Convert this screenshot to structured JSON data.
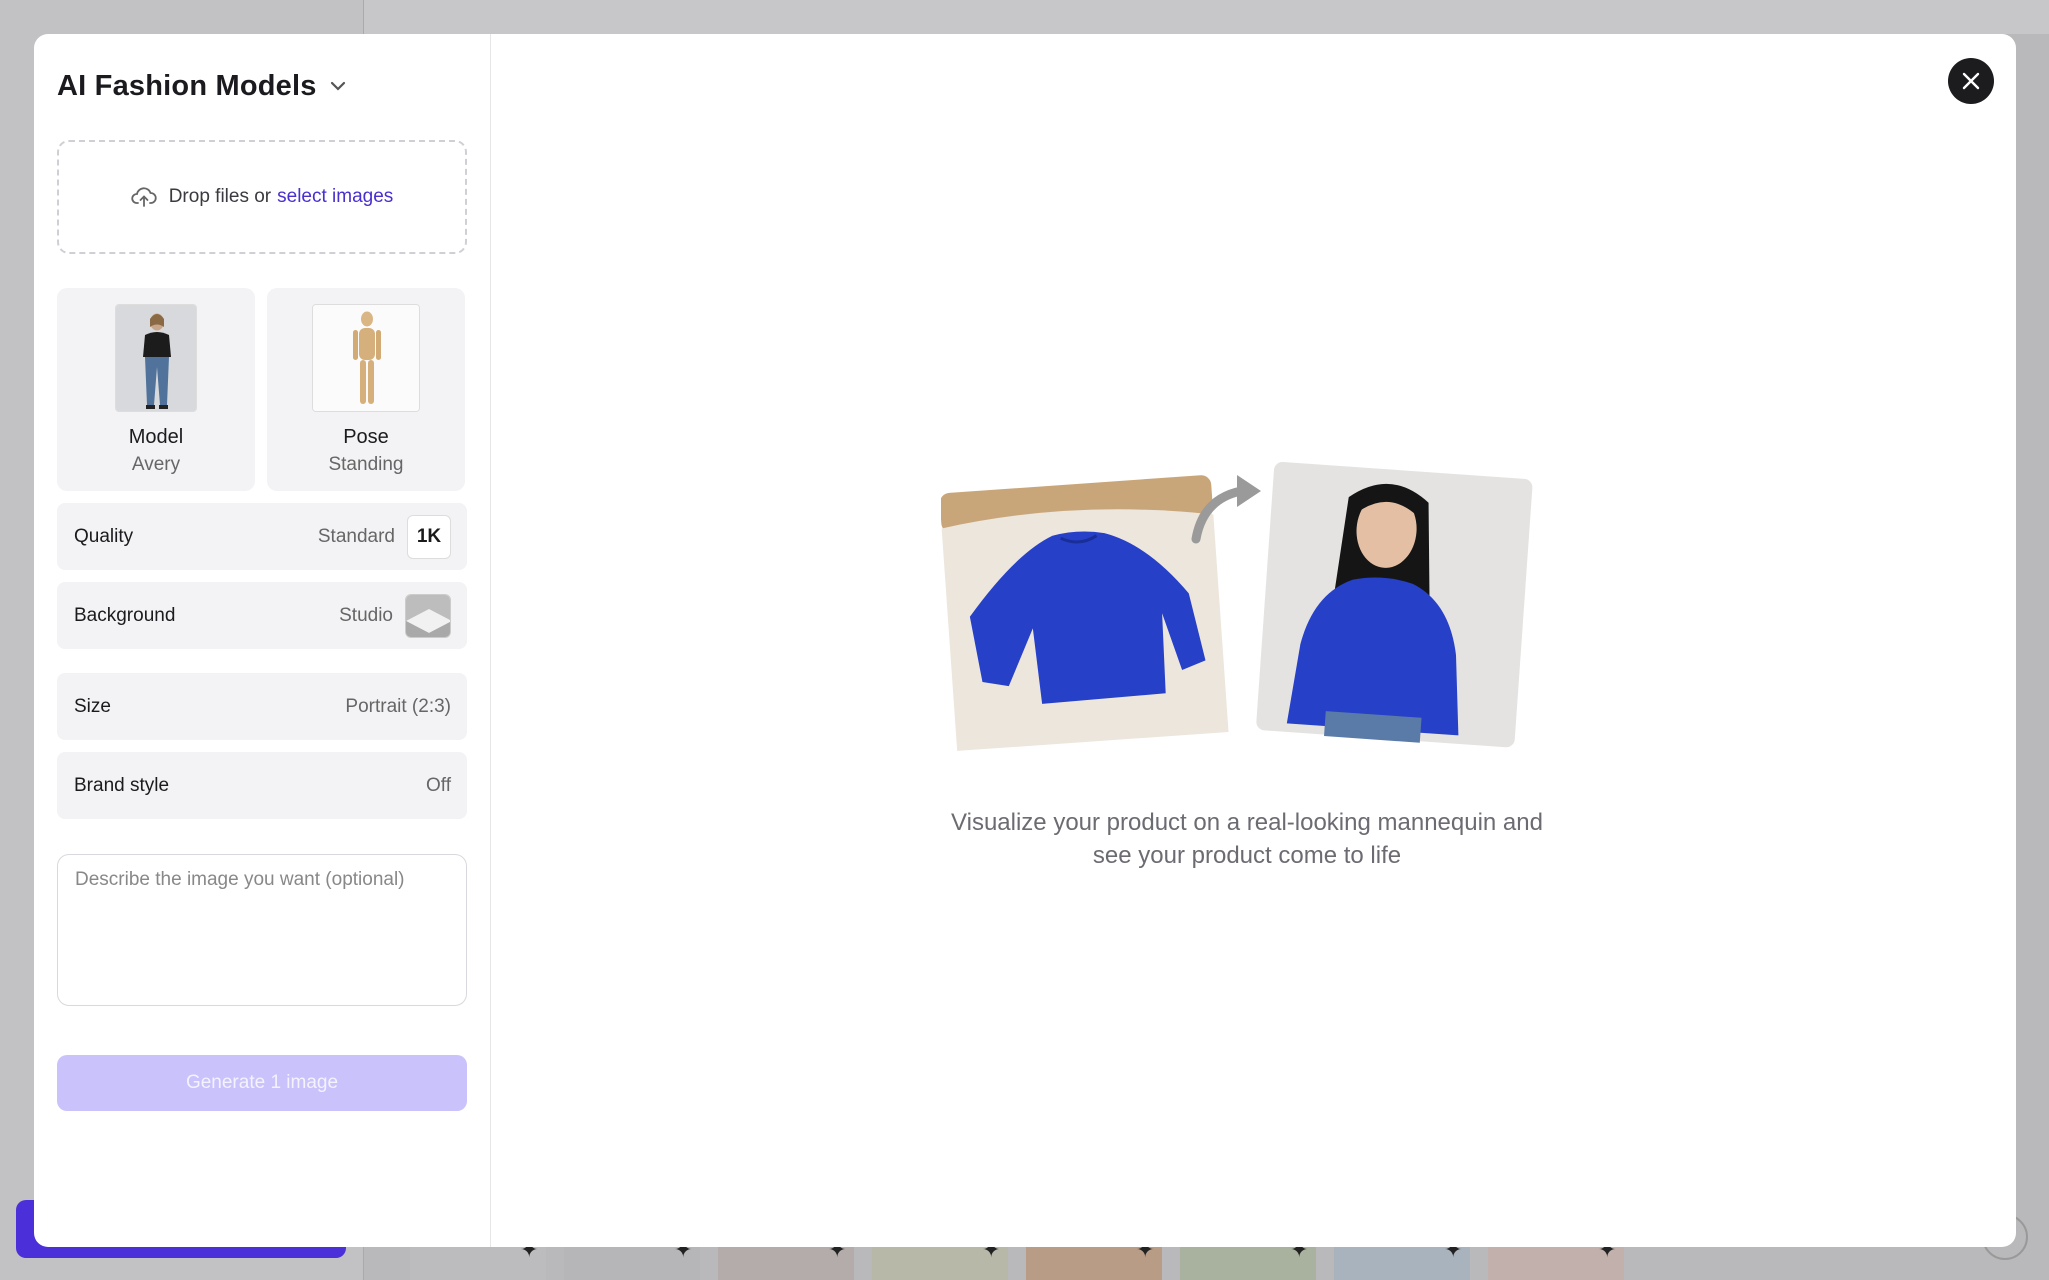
{
  "panel": {
    "title": "AI Fashion Models",
    "dropzone": {
      "text": "Drop files or",
      "link": "select images"
    },
    "model": {
      "label": "Model",
      "value": "Avery"
    },
    "pose": {
      "label": "Pose",
      "value": "Standing"
    },
    "options": {
      "quality": {
        "label": "Quality",
        "value": "Standard",
        "badge": "1K"
      },
      "background": {
        "label": "Background",
        "value": "Studio"
      },
      "size": {
        "label": "Size",
        "value": "Portrait (2:3)"
      },
      "brand_style": {
        "label": "Brand style",
        "value": "Off"
      }
    },
    "prompt_placeholder": "Describe the image you want (optional)",
    "generate_label": "Generate 1 image"
  },
  "preview": {
    "caption_line1": "Visualize your product on a real-looking mannequin and",
    "caption_line2": "see your product come to life"
  },
  "colors": {
    "accent": "#4a2fcf",
    "button_disabled": "#c9c2fb",
    "sweater": "#2640c8"
  },
  "icons": [
    "chevron-down-icon",
    "upload-cloud-icon",
    "close-icon",
    "arrow-icon"
  ]
}
